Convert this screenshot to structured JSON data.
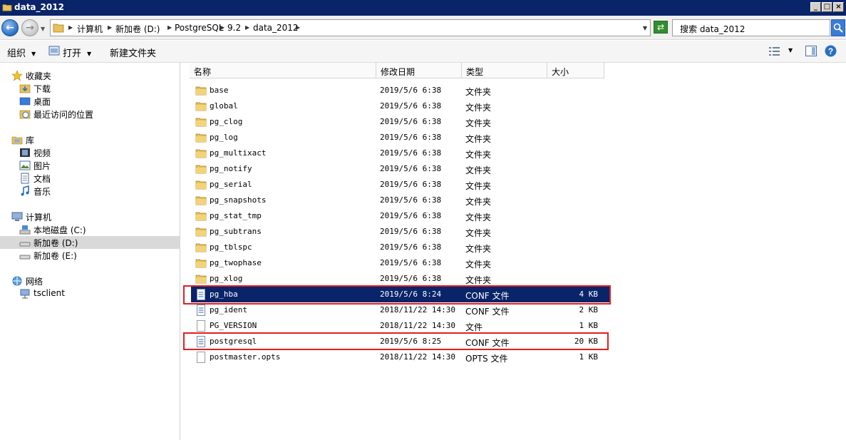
{
  "window": {
    "title": "data_2012"
  },
  "address": {
    "breadcrumbs": [
      "计算机",
      "新加卷 (D:)",
      "PostgreSQL",
      "9.2",
      "data_2012"
    ]
  },
  "search": {
    "placeholder": "搜索 data_2012"
  },
  "toolbar": {
    "organize": "组织",
    "open": "打开",
    "new_folder": "新建文件夹"
  },
  "nav": {
    "favorites": {
      "label": "收藏夹",
      "items": [
        "下载",
        "桌面",
        "最近访问的位置"
      ]
    },
    "libraries": {
      "label": "库",
      "items": [
        "视频",
        "图片",
        "文档",
        "音乐"
      ]
    },
    "computer": {
      "label": "计算机",
      "items": [
        "本地磁盘 (C:)",
        "新加卷 (D:)",
        "新加卷 (E:)"
      ]
    },
    "network": {
      "label": "网络",
      "items": [
        "tsclient"
      ]
    }
  },
  "columns": {
    "name": "名称",
    "date": "修改日期",
    "type": "类型",
    "size": "大小"
  },
  "files": [
    {
      "name": "base",
      "date": "2019/5/6 6:38",
      "type": "文件夹",
      "size": "",
      "kind": "folder"
    },
    {
      "name": "global",
      "date": "2019/5/6 6:38",
      "type": "文件夹",
      "size": "",
      "kind": "folder"
    },
    {
      "name": "pg_clog",
      "date": "2019/5/6 6:38",
      "type": "文件夹",
      "size": "",
      "kind": "folder"
    },
    {
      "name": "pg_log",
      "date": "2019/5/6 6:38",
      "type": "文件夹",
      "size": "",
      "kind": "folder"
    },
    {
      "name": "pg_multixact",
      "date": "2019/5/6 6:38",
      "type": "文件夹",
      "size": "",
      "kind": "folder"
    },
    {
      "name": "pg_notify",
      "date": "2019/5/6 6:38",
      "type": "文件夹",
      "size": "",
      "kind": "folder"
    },
    {
      "name": "pg_serial",
      "date": "2019/5/6 6:38",
      "type": "文件夹",
      "size": "",
      "kind": "folder"
    },
    {
      "name": "pg_snapshots",
      "date": "2019/5/6 6:38",
      "type": "文件夹",
      "size": "",
      "kind": "folder"
    },
    {
      "name": "pg_stat_tmp",
      "date": "2019/5/6 6:38",
      "type": "文件夹",
      "size": "",
      "kind": "folder"
    },
    {
      "name": "pg_subtrans",
      "date": "2019/5/6 6:38",
      "type": "文件夹",
      "size": "",
      "kind": "folder"
    },
    {
      "name": "pg_tblspc",
      "date": "2019/5/6 6:38",
      "type": "文件夹",
      "size": "",
      "kind": "folder"
    },
    {
      "name": "pg_twophase",
      "date": "2019/5/6 6:38",
      "type": "文件夹",
      "size": "",
      "kind": "folder"
    },
    {
      "name": "pg_xlog",
      "date": "2019/5/6 6:38",
      "type": "文件夹",
      "size": "",
      "kind": "folder"
    },
    {
      "name": "pg_hba",
      "date": "2019/5/6 8:24",
      "type": "CONF 文件",
      "size": "4 KB",
      "kind": "conf"
    },
    {
      "name": "pg_ident",
      "date": "2018/11/22 14:30",
      "type": "CONF 文件",
      "size": "2 KB",
      "kind": "conf"
    },
    {
      "name": "PG_VERSION",
      "date": "2018/11/22 14:30",
      "type": "文件",
      "size": "1 KB",
      "kind": "file"
    },
    {
      "name": "postgresql",
      "date": "2019/5/6 8:25",
      "type": "CONF 文件",
      "size": "20 KB",
      "kind": "conf"
    },
    {
      "name": "postmaster.opts",
      "date": "2018/11/22 14:30",
      "type": "OPTS 文件",
      "size": "1 KB",
      "kind": "file"
    }
  ],
  "colors": {
    "selection": "#0a246a",
    "highlight": "#e02020",
    "folder": "#e8c15a"
  }
}
